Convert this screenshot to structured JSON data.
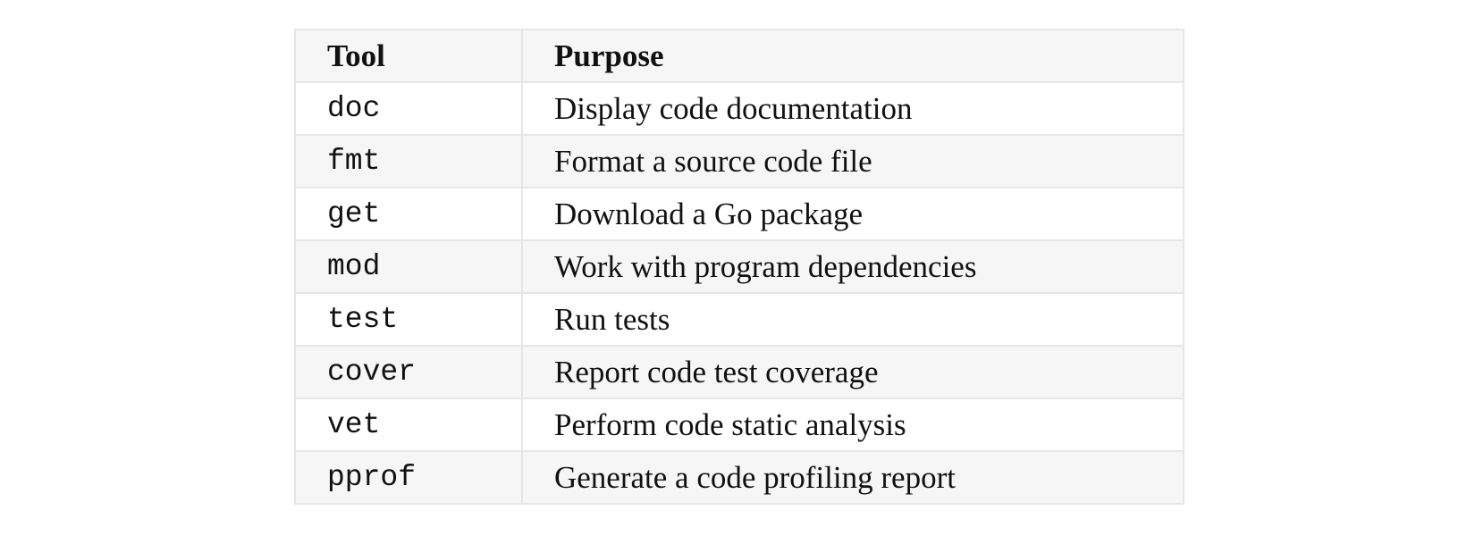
{
  "table": {
    "headers": [
      "Tool",
      "Purpose"
    ],
    "rows": [
      {
        "tool": "doc",
        "purpose": "Display code documentation"
      },
      {
        "tool": "fmt",
        "purpose": "Format a source code file"
      },
      {
        "tool": "get",
        "purpose": "Download a Go package"
      },
      {
        "tool": "mod",
        "purpose": "Work with program dependencies"
      },
      {
        "tool": "test",
        "purpose": "Run tests"
      },
      {
        "tool": "cover",
        "purpose": "Report code test coverage"
      },
      {
        "tool": "vet",
        "purpose": "Perform code static analysis"
      },
      {
        "tool": "pprof",
        "purpose": "Generate a code profiling report"
      }
    ]
  }
}
